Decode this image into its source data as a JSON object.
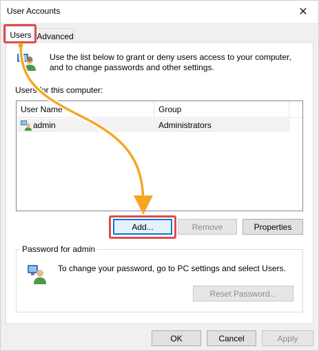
{
  "window": {
    "title": "User Accounts",
    "close_glyph": "✕"
  },
  "tabs": [
    {
      "label": "Users",
      "selected": true
    },
    {
      "label": "Advanced",
      "selected": false
    }
  ],
  "intro_text": "Use the list below to grant or deny users access to your computer, and to change passwords and other settings.",
  "users_list": {
    "label": "Users for this computer:",
    "columns": [
      "User Name",
      "Group"
    ],
    "rows": [
      {
        "user_name": "admin",
        "group": "Administrators"
      }
    ]
  },
  "list_buttons": {
    "add": "Add...",
    "remove": "Remove",
    "properties": "Properties"
  },
  "password_group": {
    "title": "Password for admin",
    "text": "To change your password, go to PC settings and select Users.",
    "reset_button": "Reset Password..."
  },
  "dialog_buttons": {
    "ok": "OK",
    "cancel": "Cancel",
    "apply": "Apply"
  },
  "colors": {
    "highlight_box": "#e04a4a",
    "annotation_arrow": "#f5a623",
    "focus_border": "#0078d7"
  },
  "icons": {
    "users": "users-icon",
    "user_row": "user-icon",
    "admin": "admin-user-icon"
  }
}
